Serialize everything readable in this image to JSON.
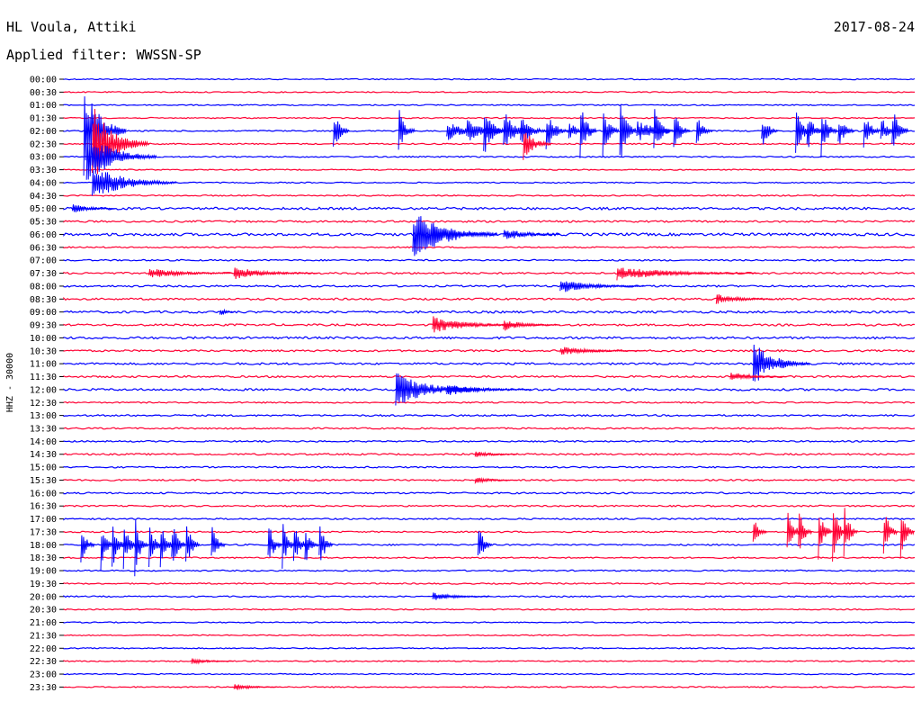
{
  "chart_data": {
    "type": "helicorder",
    "title": "HL Voula, Attiki",
    "date": "2017-08-24",
    "filter_text": "Applied filter: WWSSN-SP",
    "ylabel": "HHZ - 30000",
    "colors": [
      "#0000ff",
      "#ff0033"
    ],
    "tick_labels": [
      "00:00",
      "00:30",
      "01:00",
      "01:30",
      "02:00",
      "02:30",
      "03:00",
      "03:30",
      "04:00",
      "04:30",
      "05:00",
      "05:30",
      "06:00",
      "06:30",
      "07:00",
      "07:30",
      "08:00",
      "08:30",
      "09:00",
      "09:30",
      "10:00",
      "10:30",
      "11:00",
      "11:30",
      "12:00",
      "12:30",
      "13:00",
      "13:30",
      "14:00",
      "14:30",
      "15:00",
      "15:30",
      "16:00",
      "16:30",
      "17:00",
      "17:30",
      "18:00",
      "18:30",
      "19:00",
      "19:30",
      "20:00",
      "20:30",
      "21:00",
      "21:30",
      "22:00",
      "22:30",
      "23:00",
      "23:30"
    ],
    "row_noise": [
      0.6,
      0.6,
      0.6,
      0.6,
      0.7,
      0.7,
      0.7,
      0.6,
      0.6,
      0.7,
      1.3,
      1.0,
      1.5,
      0.7,
      0.8,
      1.0,
      1.0,
      1.0,
      1.2,
      1.1,
      1.2,
      1.0,
      1.1,
      1.0,
      1.2,
      0.7,
      0.9,
      0.8,
      0.8,
      0.9,
      0.8,
      0.8,
      0.9,
      0.8,
      0.8,
      0.8,
      0.8,
      0.7,
      0.7,
      0.7,
      0.7,
      0.6,
      0.6,
      0.6,
      0.6,
      0.6,
      0.6,
      0.6
    ],
    "events": [
      {
        "row": 4,
        "minute": 0.7,
        "amplitude": 55,
        "duration": 1.5
      },
      {
        "row": 5,
        "minute": 1.0,
        "amplitude": 45,
        "duration": 2
      },
      {
        "row": 6,
        "minute": 0.8,
        "amplitude": 30,
        "duration": 2.5
      },
      {
        "row": 8,
        "minute": 1.0,
        "amplitude": 20,
        "duration": 3
      },
      {
        "row": 4,
        "minute": 9.5,
        "amplitude": 25,
        "duration": 0.6
      },
      {
        "row": 4,
        "minute": 11.8,
        "amplitude": 30,
        "duration": 0.6
      },
      {
        "row": 4,
        "minute": 13.5,
        "amplitude": 12,
        "duration": 1.5
      },
      {
        "row": 4,
        "minute": 14.2,
        "amplitude": 14,
        "duration": 1.5
      },
      {
        "row": 4,
        "minute": 14.8,
        "amplitude": 30,
        "duration": 0.8
      },
      {
        "row": 4,
        "minute": 15.5,
        "amplitude": 25,
        "duration": 1
      },
      {
        "row": 4,
        "minute": 16.1,
        "amplitude": 18,
        "duration": 1
      },
      {
        "row": 4,
        "minute": 17.0,
        "amplitude": 25,
        "duration": 0.8
      },
      {
        "row": 4,
        "minute": 17.8,
        "amplitude": 12,
        "duration": 0.8
      },
      {
        "row": 5,
        "minute": 16.2,
        "amplitude": 20,
        "duration": 1
      },
      {
        "row": 4,
        "minute": 18.2,
        "amplitude": 35,
        "duration": 0.6
      },
      {
        "row": 4,
        "minute": 19.0,
        "amplitude": 30,
        "duration": 0.6
      },
      {
        "row": 4,
        "minute": 19.6,
        "amplitude": 45,
        "duration": 0.6
      },
      {
        "row": 4,
        "minute": 20.2,
        "amplitude": 15,
        "duration": 1.5
      },
      {
        "row": 4,
        "minute": 20.8,
        "amplitude": 30,
        "duration": 0.6
      },
      {
        "row": 4,
        "minute": 21.5,
        "amplitude": 25,
        "duration": 0.6
      },
      {
        "row": 4,
        "minute": 22.3,
        "amplitude": 20,
        "duration": 0.6
      },
      {
        "row": 4,
        "minute": 24.6,
        "amplitude": 22,
        "duration": 0.6
      },
      {
        "row": 4,
        "minute": 25.8,
        "amplitude": 30,
        "duration": 0.6
      },
      {
        "row": 4,
        "minute": 26.2,
        "amplitude": 25,
        "duration": 0.6
      },
      {
        "row": 4,
        "minute": 26.7,
        "amplitude": 30,
        "duration": 0.6
      },
      {
        "row": 4,
        "minute": 27.3,
        "amplitude": 20,
        "duration": 0.6
      },
      {
        "row": 4,
        "minute": 28.2,
        "amplitude": 25,
        "duration": 0.6
      },
      {
        "row": 4,
        "minute": 28.8,
        "amplitude": 20,
        "duration": 0.6
      },
      {
        "row": 4,
        "minute": 29.2,
        "amplitude": 30,
        "duration": 0.6
      },
      {
        "row": 12,
        "minute": 12.3,
        "amplitude": 30,
        "duration": 3
      },
      {
        "row": 12,
        "minute": 13.0,
        "amplitude": 12,
        "duration": 2
      },
      {
        "row": 12,
        "minute": 15.5,
        "amplitude": 8,
        "duration": 2
      },
      {
        "row": 10,
        "minute": 0.3,
        "amplitude": 6,
        "duration": 1.5
      },
      {
        "row": 15,
        "minute": 3.0,
        "amplitude": 6,
        "duration": 3
      },
      {
        "row": 15,
        "minute": 6.0,
        "amplitude": 7,
        "duration": 3
      },
      {
        "row": 15,
        "minute": 19.5,
        "amplitude": 8,
        "duration": 5
      },
      {
        "row": 16,
        "minute": 17.5,
        "amplitude": 8,
        "duration": 3
      },
      {
        "row": 17,
        "minute": 23.0,
        "amplitude": 6,
        "duration": 2
      },
      {
        "row": 18,
        "minute": 5.5,
        "amplitude": 6,
        "duration": 0.5
      },
      {
        "row": 19,
        "minute": 13.0,
        "amplitude": 10,
        "duration": 3
      },
      {
        "row": 19,
        "minute": 15.5,
        "amplitude": 7,
        "duration": 2
      },
      {
        "row": 21,
        "minute": 17.5,
        "amplitude": 5,
        "duration": 3
      },
      {
        "row": 22,
        "minute": 24.3,
        "amplitude": 25,
        "duration": 2
      },
      {
        "row": 23,
        "minute": 23.5,
        "amplitude": 6,
        "duration": 2
      },
      {
        "row": 24,
        "minute": 11.7,
        "amplitude": 20,
        "duration": 3
      },
      {
        "row": 24,
        "minute": 13.5,
        "amplitude": 7,
        "duration": 3
      },
      {
        "row": 29,
        "minute": 14.5,
        "amplitude": 4,
        "duration": 1.5
      },
      {
        "row": 31,
        "minute": 14.5,
        "amplitude": 4,
        "duration": 1.5
      },
      {
        "row": 36,
        "minute": 0.6,
        "amplitude": 30,
        "duration": 0.5
      },
      {
        "row": 36,
        "minute": 1.3,
        "amplitude": 30,
        "duration": 0.5
      },
      {
        "row": 36,
        "minute": 1.7,
        "amplitude": 35,
        "duration": 0.5
      },
      {
        "row": 36,
        "minute": 2.1,
        "amplitude": 28,
        "duration": 0.5
      },
      {
        "row": 36,
        "minute": 2.5,
        "amplitude": 35,
        "duration": 0.5
      },
      {
        "row": 36,
        "minute": 3.0,
        "amplitude": 28,
        "duration": 0.5
      },
      {
        "row": 36,
        "minute": 3.4,
        "amplitude": 30,
        "duration": 0.5
      },
      {
        "row": 36,
        "minute": 3.8,
        "amplitude": 35,
        "duration": 0.5
      },
      {
        "row": 36,
        "minute": 4.3,
        "amplitude": 30,
        "duration": 0.5
      },
      {
        "row": 36,
        "minute": 5.2,
        "amplitude": 25,
        "duration": 0.5
      },
      {
        "row": 36,
        "minute": 7.2,
        "amplitude": 30,
        "duration": 0.5
      },
      {
        "row": 36,
        "minute": 7.7,
        "amplitude": 28,
        "duration": 0.5
      },
      {
        "row": 36,
        "minute": 8.1,
        "amplitude": 30,
        "duration": 0.5
      },
      {
        "row": 36,
        "minute": 8.5,
        "amplitude": 25,
        "duration": 0.5
      },
      {
        "row": 36,
        "minute": 9.0,
        "amplitude": 30,
        "duration": 0.5
      },
      {
        "row": 36,
        "minute": 14.6,
        "amplitude": 25,
        "duration": 0.5
      },
      {
        "row": 40,
        "minute": 13.0,
        "amplitude": 5,
        "duration": 2
      },
      {
        "row": 35,
        "minute": 24.3,
        "amplitude": 18,
        "duration": 0.5
      },
      {
        "row": 35,
        "minute": 25.5,
        "amplitude": 35,
        "duration": 0.5
      },
      {
        "row": 35,
        "minute": 25.9,
        "amplitude": 30,
        "duration": 0.5
      },
      {
        "row": 35,
        "minute": 26.6,
        "amplitude": 32,
        "duration": 0.5
      },
      {
        "row": 35,
        "minute": 27.1,
        "amplitude": 38,
        "duration": 0.5
      },
      {
        "row": 35,
        "minute": 27.5,
        "amplitude": 35,
        "duration": 0.5
      },
      {
        "row": 35,
        "minute": 28.9,
        "amplitude": 32,
        "duration": 0.5
      },
      {
        "row": 35,
        "minute": 29.5,
        "amplitude": 35,
        "duration": 0.5
      },
      {
        "row": 45,
        "minute": 4.5,
        "amplitude": 4,
        "duration": 1.5
      },
      {
        "row": 47,
        "minute": 6.0,
        "amplitude": 4,
        "duration": 1.5
      }
    ]
  }
}
